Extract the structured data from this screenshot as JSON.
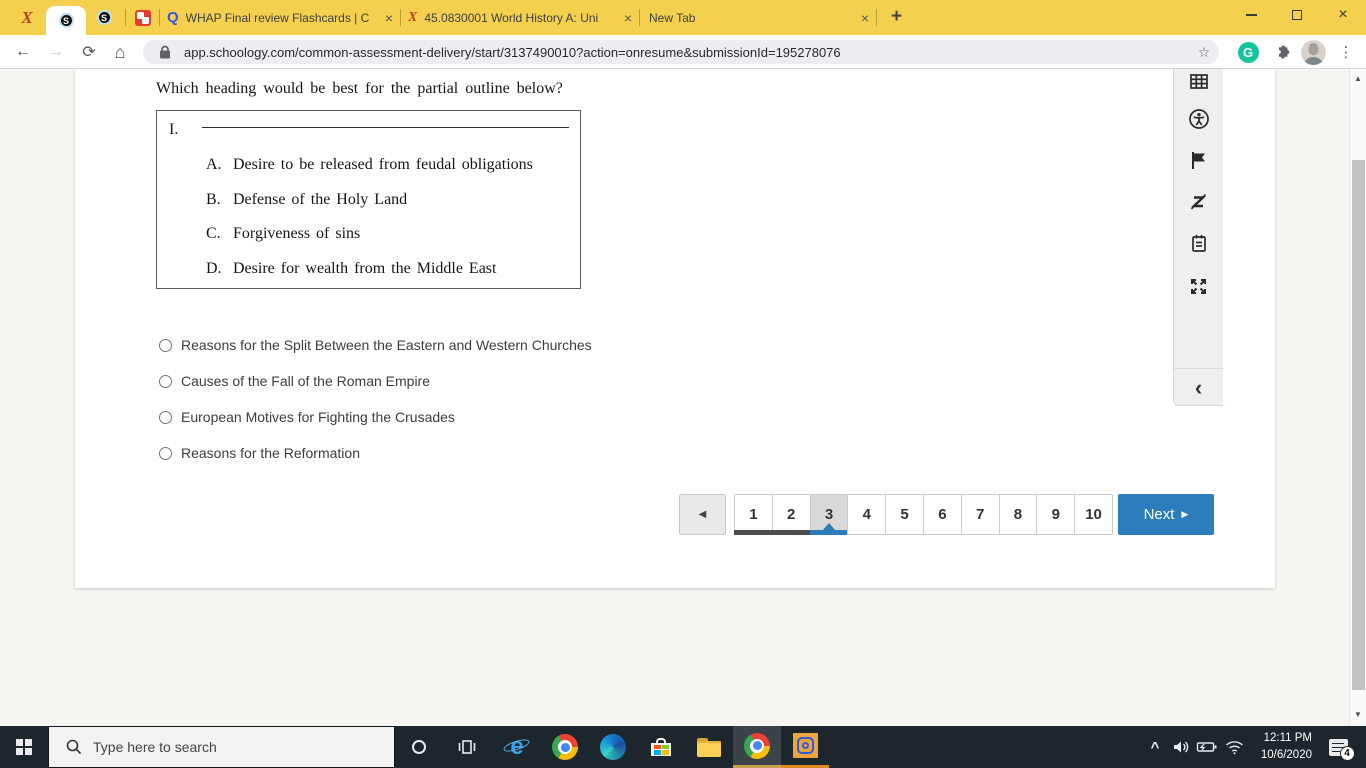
{
  "colors": {
    "tab_bar_yellow": "#f5d04e",
    "accent_blue": "#2b7dbc",
    "answered_bar_gray": "#4d4d4d",
    "taskbar_dark": "#1d262c",
    "grammarly_green": "#15c39a",
    "schoology_red_pin": "#e23c31"
  },
  "browser": {
    "pinned_tab_icons": [
      "x-logo-icon",
      "schoology-icon-active",
      "schoology-icon",
      "red-app-icon"
    ],
    "tabs": [
      {
        "title": "WHAP Final review Flashcards | C",
        "favicon": "quizlet-icon"
      },
      {
        "title": "45.0830001 World History A: Uni",
        "favicon": "x-logo-icon"
      },
      {
        "title": "New Tab",
        "favicon": "none"
      }
    ],
    "url": "app.schoology.com/common-assessment-delivery/start/3137490010?action=onresume&submissionId=195278076",
    "icons": {
      "x_logo": "X",
      "schoology_letter": "S",
      "quizlet_letter": "Q",
      "grammarly_letter": "G",
      "ie_letter": "e",
      "tab_close": "×",
      "new_tab": "+",
      "window_close": "×",
      "back": "←",
      "forward": "→",
      "reload": "⟳",
      "home": "⌂",
      "star": "☆",
      "menu_kebab": "⋮",
      "scroll_up": "▲",
      "scroll_down": "▼"
    }
  },
  "assessment": {
    "question_prompt": "Which heading would be best for the partial outline below?",
    "outline": {
      "numeral": "I.",
      "items": [
        {
          "letter": "A.",
          "text": "Desire to be released from feudal obligations"
        },
        {
          "letter": "B.",
          "text": "Defense of the Holy Land"
        },
        {
          "letter": "C.",
          "text": "Forgiveness of sins"
        },
        {
          "letter": "D.",
          "text": "Desire for wealth from the Middle East"
        }
      ]
    },
    "choices": [
      "Reasons for the Split Between the Eastern and Western Churches",
      "Causes of the Fall of the Roman Empire",
      "European Motives for Fighting the Crusades",
      "Reasons for the Reformation"
    ],
    "pagination": {
      "prev_icon": "◀",
      "pages": [
        "1",
        "2",
        "3",
        "4",
        "5",
        "6",
        "7",
        "8",
        "9",
        "10"
      ],
      "current_page": "3",
      "answered_pages": [
        "1",
        "2"
      ],
      "next_label": "Next",
      "next_icon": "▶"
    },
    "tool_icons": [
      "question-grid-icon",
      "accessibility-icon",
      "flag-icon",
      "answer-eliminator-icon",
      "notes-icon",
      "fullscreen-icon"
    ],
    "collapse_icon": "‹"
  },
  "taskbar": {
    "search_placeholder": "Type here to search",
    "app_icons": [
      "start-icon",
      "cortana-icon",
      "task-view-icon",
      "internet-explorer-icon",
      "chrome-icon",
      "edge-icon",
      "store-icon",
      "file-explorer-icon",
      "chrome-icon-active",
      "camera-app-icon"
    ],
    "tray_icons": [
      "tray-chevron-icon",
      "speaker-icon",
      "battery-icon",
      "wifi-icon"
    ],
    "tray_chevron": "^",
    "clock": {
      "time": "12:11 PM",
      "date": "10/6/2020"
    },
    "notification_count": "4"
  }
}
